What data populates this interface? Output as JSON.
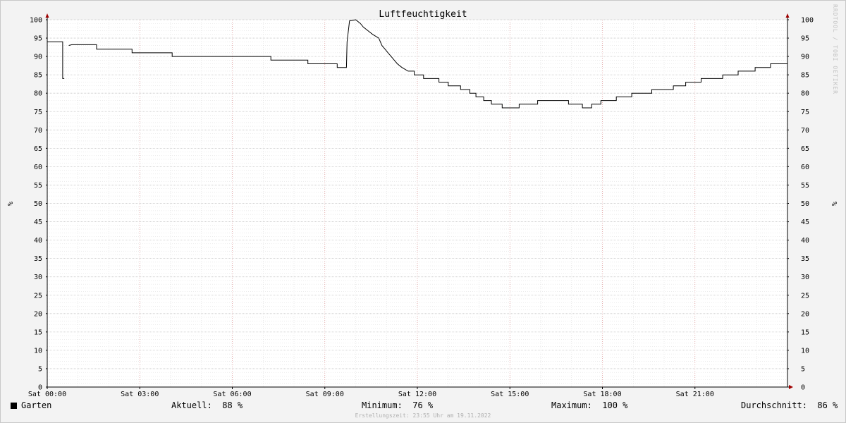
{
  "watermark": "RRDTOOL / TOBI OETIKER",
  "chart_data": {
    "type": "line",
    "title": "Luftfeuchtigkeit",
    "ylabel": "%",
    "ylim": [
      0,
      100
    ],
    "yticks": [
      0,
      5,
      10,
      15,
      20,
      25,
      30,
      35,
      40,
      45,
      50,
      55,
      60,
      65,
      70,
      75,
      80,
      85,
      90,
      95,
      100
    ],
    "xlim": [
      0,
      24
    ],
    "xtick_labels": [
      "Sat 00:00",
      "Sat 03:00",
      "Sat 06:00",
      "Sat 09:00",
      "Sat 12:00",
      "Sat 15:00",
      "Sat 18:00",
      "Sat 21:00"
    ],
    "xtick_hours": [
      0,
      3,
      6,
      9,
      12,
      15,
      18,
      21
    ],
    "grid": true,
    "series": [
      {
        "name": "Garten",
        "color": "#000000",
        "segments": [
          [
            [
              0,
              94
            ],
            [
              0.5,
              94
            ],
            [
              0.5,
              84
            ],
            [
              0.55,
              84
            ]
          ],
          [
            [
              0.7,
              93
            ],
            [
              0.8,
              93.2
            ],
            [
              1.6,
              93.2
            ],
            [
              1.6,
              92
            ],
            [
              2.75,
              92
            ],
            [
              2.75,
              91
            ],
            [
              4.05,
              91
            ],
            [
              4.05,
              90
            ],
            [
              7.25,
              90
            ],
            [
              7.25,
              89
            ],
            [
              8.45,
              89
            ],
            [
              8.45,
              88
            ],
            [
              9.4,
              88
            ],
            [
              9.4,
              87
            ],
            [
              9.7,
              87
            ],
            [
              9.72,
              94
            ],
            [
              9.8,
              99.7
            ],
            [
              10.0,
              100
            ],
            [
              10.15,
              99
            ],
            [
              10.25,
              98
            ],
            [
              10.4,
              97
            ],
            [
              10.55,
              96
            ],
            [
              10.75,
              95
            ],
            [
              10.85,
              93
            ],
            [
              10.95,
              92
            ],
            [
              11.05,
              91
            ],
            [
              11.15,
              90
            ],
            [
              11.25,
              89
            ],
            [
              11.35,
              88
            ],
            [
              11.5,
              87
            ],
            [
              11.7,
              86
            ],
            [
              11.9,
              86
            ],
            [
              11.9,
              85
            ],
            [
              12.2,
              85
            ],
            [
              12.2,
              84
            ],
            [
              12.7,
              84
            ],
            [
              12.7,
              83
            ],
            [
              13.0,
              83
            ],
            [
              13.0,
              82
            ],
            [
              13.4,
              82
            ],
            [
              13.4,
              81
            ],
            [
              13.7,
              81
            ],
            [
              13.7,
              80
            ],
            [
              13.9,
              80
            ],
            [
              13.9,
              79
            ],
            [
              14.15,
              79
            ],
            [
              14.15,
              78
            ],
            [
              14.4,
              78
            ],
            [
              14.4,
              77
            ],
            [
              14.75,
              77
            ],
            [
              14.75,
              76
            ],
            [
              15.3,
              76
            ],
            [
              15.3,
              77
            ],
            [
              15.9,
              77
            ],
            [
              15.9,
              78
            ],
            [
              16.9,
              78
            ],
            [
              16.9,
              77
            ],
            [
              17.35,
              77
            ],
            [
              17.35,
              76
            ],
            [
              17.65,
              76
            ],
            [
              17.65,
              77
            ],
            [
              17.95,
              77
            ],
            [
              17.95,
              78
            ],
            [
              18.45,
              78
            ],
            [
              18.45,
              79
            ],
            [
              18.95,
              79
            ],
            [
              18.95,
              80
            ],
            [
              19.6,
              80
            ],
            [
              19.6,
              81
            ],
            [
              20.3,
              81
            ],
            [
              20.3,
              82
            ],
            [
              20.7,
              82
            ],
            [
              20.7,
              83
            ],
            [
              21.2,
              83
            ],
            [
              21.2,
              84
            ],
            [
              21.9,
              84
            ],
            [
              21.9,
              85
            ],
            [
              22.4,
              85
            ],
            [
              22.4,
              86
            ],
            [
              22.95,
              86
            ],
            [
              22.95,
              87
            ],
            [
              23.45,
              87
            ],
            [
              23.45,
              88
            ],
            [
              24,
              88
            ]
          ]
        ]
      }
    ],
    "legend": {
      "name": "Garten",
      "current_label": "Aktuell:",
      "current_value": "88 %",
      "min_label": "Minimum:",
      "min_value": "76 %",
      "max_label": "Maximum:",
      "max_value": "100 %",
      "avg_label": "Durchschnitt:",
      "avg_value": "86 %"
    },
    "footer": "Erstellungszeit: 23:55 Uhr am 19.11.2022",
    "colors": {
      "background": "#f3f3f3",
      "plot_background": "#ffffff",
      "minor_grid": "#d8d8d8",
      "major_grid_h": "#c8c8c8",
      "major_grid_v": "#e0a0a0",
      "axis_arrow": "#a00000",
      "line": "#000000"
    }
  }
}
